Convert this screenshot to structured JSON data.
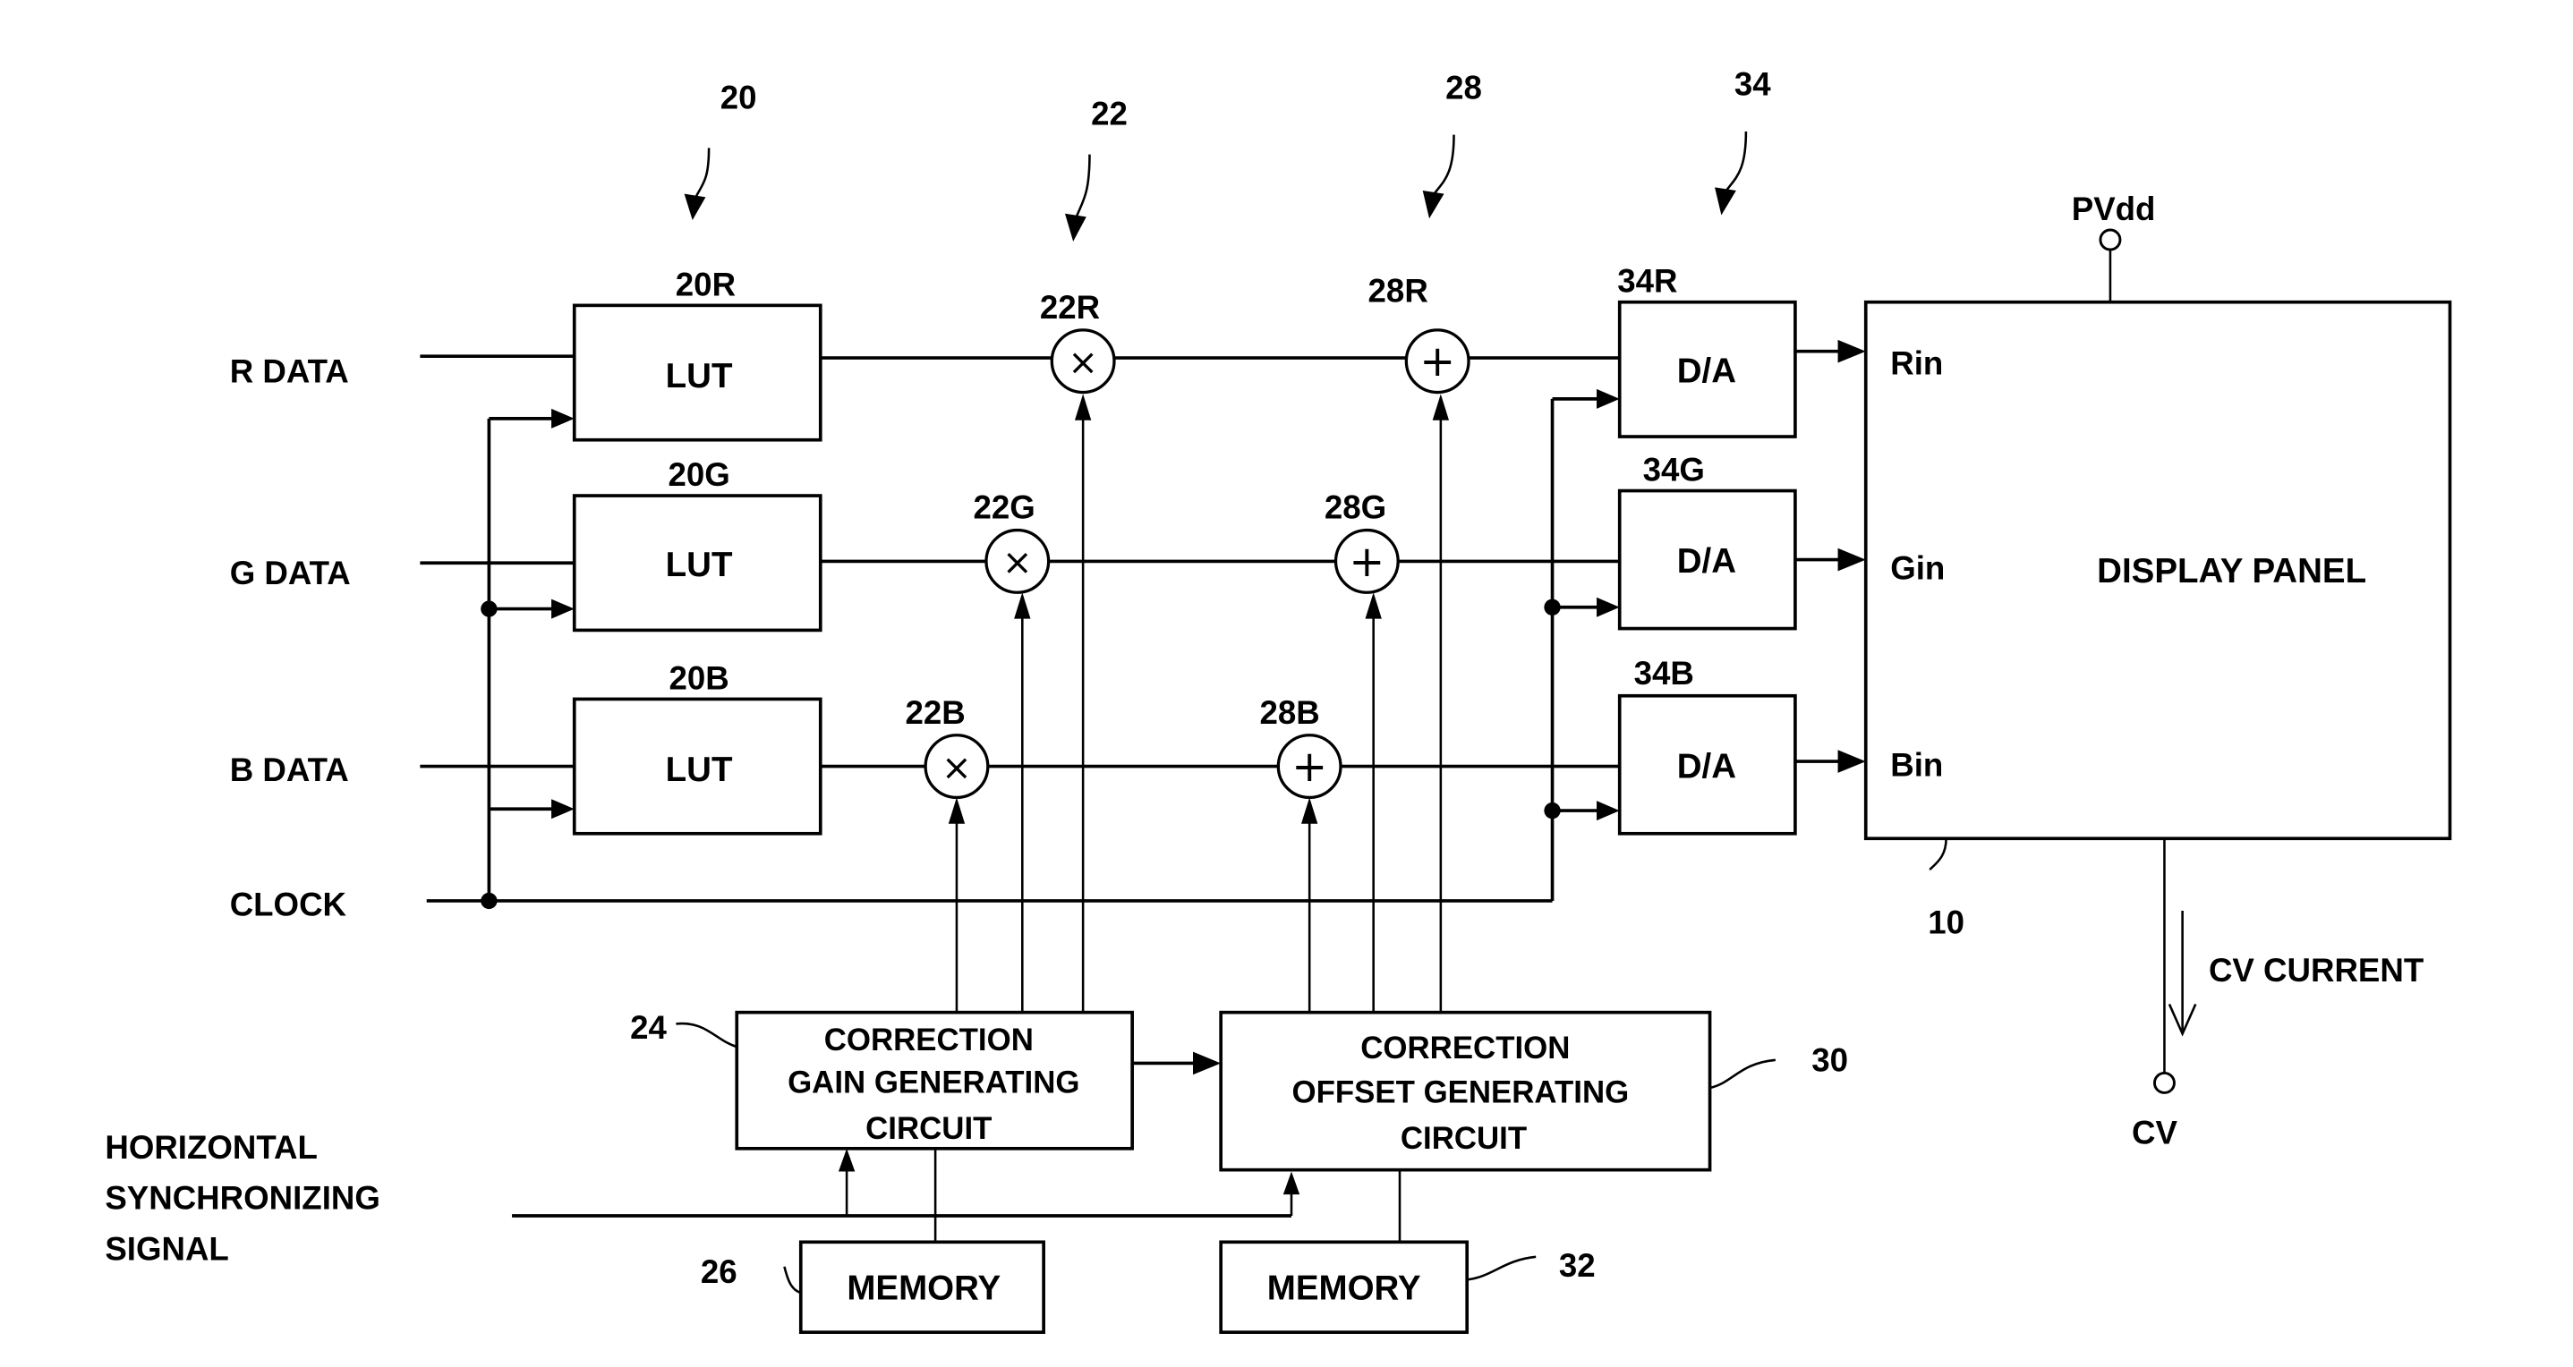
{
  "diagram": {
    "group_refs": {
      "lut_group": "20",
      "multiplier_group": "22",
      "adder_group": "28",
      "da_group": "34"
    },
    "inputs": {
      "r_data": "R DATA",
      "g_data": "G DATA",
      "b_data": "B DATA",
      "clock": "CLOCK",
      "hsync": [
        "HORIZONTAL",
        "SYNCHRONIZING",
        "SIGNAL"
      ]
    },
    "luts": [
      {
        "ref": "20R",
        "label": "LUT"
      },
      {
        "ref": "20G",
        "label": "LUT"
      },
      {
        "ref": "20B",
        "label": "LUT"
      }
    ],
    "multipliers": [
      {
        "ref": "22R",
        "symbol": "×"
      },
      {
        "ref": "22G",
        "symbol": "×"
      },
      {
        "ref": "22B",
        "symbol": "×"
      }
    ],
    "adders": [
      {
        "ref": "28R",
        "symbol": "+"
      },
      {
        "ref": "28G",
        "symbol": "+"
      },
      {
        "ref": "28B",
        "symbol": "+"
      }
    ],
    "converters": [
      {
        "ref": "34R",
        "label": "D/A"
      },
      {
        "ref": "34G",
        "label": "D/A"
      },
      {
        "ref": "34B",
        "label": "D/A"
      }
    ],
    "display_panel": {
      "ref": "10",
      "label": "DISPLAY PANEL",
      "inputs": [
        "Rin",
        "Gin",
        "Bin"
      ],
      "supply": "PVdd",
      "output": "CV",
      "current_label": "CV CURRENT"
    },
    "gain_circuit": {
      "ref": "24",
      "lines": [
        "CORRECTION",
        "GAIN GENERATING",
        "CIRCUIT"
      ]
    },
    "offset_circuit": {
      "ref": "30",
      "lines": [
        "CORRECTION",
        "OFFSET GENERATING",
        "CIRCUIT"
      ]
    },
    "gain_memory": {
      "ref": "26",
      "label": "MEMORY"
    },
    "offset_memory": {
      "ref": "32",
      "label": "MEMORY"
    }
  }
}
